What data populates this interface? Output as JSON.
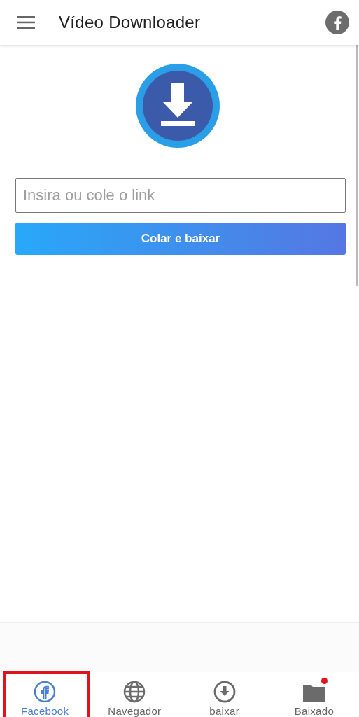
{
  "app_bar": {
    "title": "Vídeo Downloader"
  },
  "form": {
    "placeholder": "Insira ou cole o link",
    "button": "Colar e baixar"
  },
  "tabs": [
    {
      "kind": "facebook",
      "label": "Facebook",
      "selected": true,
      "highlighted": true,
      "badge": false
    },
    {
      "kind": "globe",
      "label": "Navegador",
      "selected": false,
      "highlighted": false,
      "badge": false
    },
    {
      "kind": "download",
      "label": "baixar",
      "selected": false,
      "highlighted": false,
      "badge": false
    },
    {
      "kind": "folder",
      "label": "Baixado",
      "selected": false,
      "highlighted": false,
      "badge": true
    }
  ]
}
